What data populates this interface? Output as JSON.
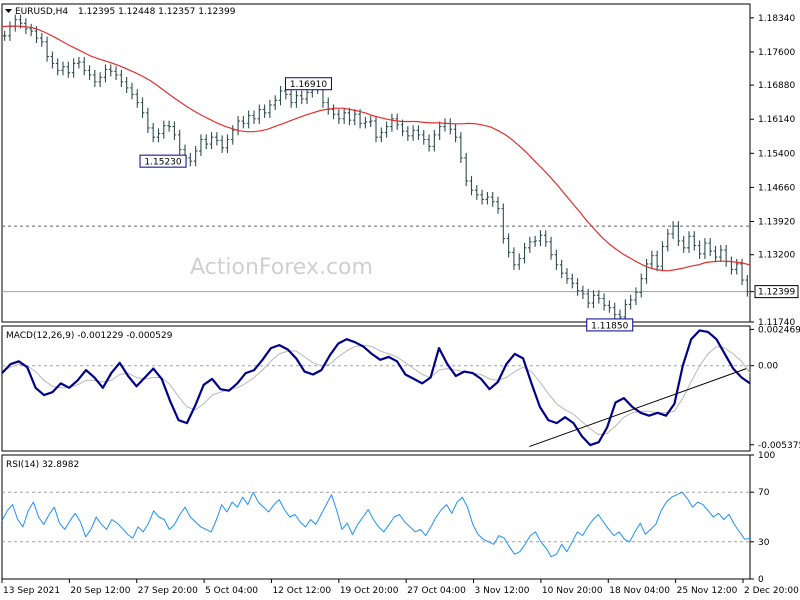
{
  "chart_data": {
    "type": "line",
    "price_panel": {
      "header_symbol": "EURUSD,H4",
      "header_ohlc": "1.12395 1.12448 1.12357 1.12399",
      "ylim": [
        1.1174,
        1.1864
      ],
      "y_ticks": [
        "1.18340",
        "1.17600",
        "1.16880",
        "1.16140",
        "1.15400",
        "1.14660",
        "1.13920",
        "1.13200",
        "1.12399",
        "1.11740"
      ],
      "annotations": [
        {
          "text": "1.16910",
          "x": 59,
          "y": 1.1691
        },
        {
          "text": "1.15230",
          "x": 31,
          "y": 1.1523
        },
        {
          "text": "1.11850",
          "x": 117,
          "y": 1.1185
        }
      ],
      "level_lines": [
        {
          "value": 1.1382,
          "label": "1.13820",
          "style": "dashed"
        },
        {
          "value": 1.12399,
          "label": "1.12399",
          "style": "solid"
        }
      ],
      "watermark": "ActionForex.com",
      "price_series": [
        1.1795,
        1.1815,
        1.183,
        1.1822,
        1.181,
        1.1805,
        1.179,
        1.1782,
        1.175,
        1.1735,
        1.172,
        1.1728,
        1.1715,
        1.1735,
        1.1738,
        1.172,
        1.171,
        1.1695,
        1.1705,
        1.1722,
        1.1718,
        1.171,
        1.1695,
        1.1682,
        1.1668,
        1.165,
        1.1628,
        1.1595,
        1.1575,
        1.1583,
        1.16,
        1.1598,
        1.158,
        1.1548,
        1.153,
        1.1523,
        1.1545,
        1.157,
        1.156,
        1.1575,
        1.1568,
        1.1552,
        1.157,
        1.159,
        1.161,
        1.1605,
        1.1622,
        1.1615,
        1.1635,
        1.1628,
        1.1645,
        1.1655,
        1.1675,
        1.1668,
        1.165,
        1.1665,
        1.1658,
        1.1672,
        1.168,
        1.1691,
        1.165,
        1.1635,
        1.1625,
        1.1615,
        1.1628,
        1.1612,
        1.1625,
        1.1605,
        1.1608,
        1.161,
        1.1575,
        1.1585,
        1.1598,
        1.1615,
        1.1602,
        1.1588,
        1.1578,
        1.159,
        1.158,
        1.157,
        1.1555,
        1.158,
        1.1598,
        1.1605,
        1.1592,
        1.1575,
        1.153,
        1.148,
        1.146,
        1.145,
        1.144,
        1.1445,
        1.1435,
        1.142,
        1.1355,
        1.1325,
        1.1298,
        1.1312,
        1.1335,
        1.1348,
        1.135,
        1.1362,
        1.1348,
        1.132,
        1.1298,
        1.128,
        1.1268,
        1.1258,
        1.1242,
        1.1235,
        1.1215,
        1.1232,
        1.1225,
        1.121,
        1.1205,
        1.119,
        1.1185,
        1.1212,
        1.1222,
        1.1238,
        1.1268,
        1.13,
        1.1318,
        1.1295,
        1.1338,
        1.1365,
        1.1382,
        1.135,
        1.1335,
        1.136,
        1.134,
        1.1322,
        1.1345,
        1.1328,
        1.1315,
        1.133,
        1.1305,
        1.1288,
        1.13,
        1.1265,
        1.124
      ],
      "ma_series": [
        1.1815,
        1.1816,
        1.1816,
        1.1815,
        1.1813,
        1.1808,
        1.1801,
        1.1793,
        1.1784,
        1.1775,
        1.1767,
        1.1759,
        1.1751,
        1.1745,
        1.174,
        1.1735,
        1.1729,
        1.1722,
        1.1715,
        1.1707,
        1.1698,
        1.1687,
        1.1675,
        1.1663,
        1.1652,
        1.1641,
        1.1631,
        1.1622,
        1.1614,
        1.1606,
        1.1599,
        1.1594,
        1.1589,
        1.1587,
        1.1587,
        1.1589,
        1.1593,
        1.1599,
        1.1605,
        1.1611,
        1.1617,
        1.1623,
        1.1628,
        1.1633,
        1.1636,
        1.1638,
        1.1638,
        1.1635,
        1.1632,
        1.1628,
        1.1622,
        1.1618,
        1.1614,
        1.1611,
        1.1609,
        1.1609,
        1.1609,
        1.1607,
        1.1606,
        1.1606,
        1.1605,
        1.1604,
        1.1604,
        1.1605,
        1.1604,
        1.1601,
        1.1597,
        1.1589,
        1.158,
        1.1568,
        1.1554,
        1.1539,
        1.1522,
        1.1506,
        1.1489,
        1.1471,
        1.1451,
        1.1432,
        1.1413,
        1.1393,
        1.1375,
        1.1358,
        1.1343,
        1.1331,
        1.132,
        1.1311,
        1.1302,
        1.1294,
        1.1289,
        1.1286,
        1.1285,
        1.1288,
        1.1291,
        1.1295,
        1.1298,
        1.1303,
        1.1305,
        1.1306,
        1.1306,
        1.1304,
        1.1302,
        1.1298
      ]
    },
    "macd_panel": {
      "header": "MACD(12,26,9) -0.001229 -0.000529",
      "ylim": [
        -0.0058,
        0.0027
      ],
      "y_ticks": [
        "0.002469",
        "0.00",
        "-0.005375"
      ],
      "macd_series": [
        -0.0005,
        0.0001,
        0.0003,
        -0.0001,
        -0.0015,
        -0.002,
        -0.0018,
        -0.0012,
        -0.0015,
        -0.001,
        -0.0003,
        -0.0008,
        -0.0015,
        -0.0005,
        0.0002,
        -0.0007,
        -0.0014,
        -0.0008,
        -0.0002,
        -0.0009,
        -0.0024,
        -0.0037,
        -0.0039,
        -0.0027,
        -0.0013,
        -0.0009,
        -0.0016,
        -0.0017,
        -0.0012,
        -0.0005,
        -0.0003,
        0.0004,
        0.0012,
        0.0014,
        0.0011,
        0.0005,
        -0.0004,
        -0.0006,
        -0.0003,
        0.0007,
        0.0015,
        0.0018,
        0.0016,
        0.0013,
        0.0008,
        0.0004,
        0.0006,
        0.0003,
        -0.0006,
        -0.0009,
        -0.0012,
        -0.0008,
        0.0012,
        0.0001,
        -0.0007,
        -0.0004,
        -0.0005,
        -0.0009,
        -0.0016,
        -0.0011,
        0.0001,
        0.0008,
        0.0005,
        -0.0012,
        -0.0028,
        -0.0037,
        -0.0039,
        -0.0035,
        -0.0039,
        -0.0048,
        -0.0054,
        -0.0052,
        -0.0042,
        -0.0025,
        -0.0022,
        -0.0028,
        -0.0032,
        -0.0034,
        -0.0032,
        -0.0034,
        -0.0026,
        0.0,
        0.0018,
        0.0024,
        0.0023,
        0.0018,
        0.0008,
        -0.0002,
        -0.0008,
        -0.0012
      ],
      "signal_series": [
        -0.0004,
        -0.0001,
        0.0001,
        0.0,
        -0.0004,
        -0.001,
        -0.0014,
        -0.0015,
        -0.0015,
        -0.0013,
        -0.001,
        -0.001,
        -0.0011,
        -0.001,
        -0.0006,
        -0.0005,
        -0.0008,
        -0.0009,
        -0.0008,
        -0.0008,
        -0.0013,
        -0.0021,
        -0.0028,
        -0.003,
        -0.0026,
        -0.002,
        -0.0018,
        -0.0016,
        -0.0015,
        -0.0012,
        -0.0008,
        -0.0003,
        0.0003,
        0.0008,
        0.001,
        0.001,
        0.0006,
        0.0002,
        0.0,
        0.0001,
        0.0006,
        0.001,
        0.0013,
        0.0014,
        0.0013,
        0.001,
        0.0008,
        0.0006,
        0.0002,
        -0.0002,
        -0.0006,
        -0.0008,
        -0.0003,
        -0.0002,
        -0.0003,
        -0.0004,
        -0.0005,
        -0.0006,
        -0.0009,
        -0.001,
        -0.0008,
        -0.0004,
        -0.0001,
        -0.0004,
        -0.0011,
        -0.0019,
        -0.0026,
        -0.003,
        -0.0033,
        -0.0038,
        -0.0043,
        -0.0047,
        -0.0046,
        -0.0041,
        -0.0035,
        -0.0032,
        -0.0031,
        -0.0031,
        -0.0032,
        -0.0032,
        -0.0031,
        -0.0022,
        -0.0011,
        0.0,
        0.0008,
        0.0013,
        0.0012,
        0.0008,
        0.0003,
        -0.0005
      ],
      "trendline": {
        "from": [
          0.705,
          -0.0055
        ],
        "to": [
          0.995,
          -0.0002
        ]
      }
    },
    "rsi_panel": {
      "header": "RSI(14) 32.8982",
      "ylim": [
        0,
        100
      ],
      "y_ticks": [
        "100",
        "70",
        "30",
        "0"
      ],
      "levels": [
        70,
        30
      ],
      "rsi_series": [
        47,
        55,
        60,
        48,
        42,
        55,
        62,
        50,
        44,
        52,
        58,
        45,
        40,
        47,
        53,
        46,
        34,
        40,
        50,
        44,
        40,
        48,
        45,
        41,
        36,
        33,
        42,
        38,
        45,
        55,
        50,
        48,
        40,
        44,
        52,
        58,
        50,
        46,
        42,
        40,
        38,
        48,
        60,
        54,
        62,
        58,
        66,
        60,
        70,
        62,
        58,
        54,
        60,
        64,
        56,
        50,
        52,
        46,
        42,
        48,
        44,
        52,
        60,
        68,
        55,
        40,
        45,
        36,
        44,
        50,
        56,
        48,
        42,
        38,
        44,
        50,
        52,
        46,
        42,
        38,
        40,
        35,
        42,
        50,
        56,
        60,
        53,
        62,
        66,
        58,
        44,
        36,
        32,
        30,
        28,
        35,
        33,
        26,
        20,
        22,
        28,
        35,
        38,
        30,
        25,
        18,
        20,
        28,
        22,
        30,
        38,
        35,
        42,
        48,
        52,
        46,
        40,
        35,
        38,
        32,
        30,
        38,
        45,
        36,
        40,
        44,
        55,
        62,
        66,
        68,
        70,
        65,
        58,
        62,
        60,
        55,
        50,
        53,
        48,
        52,
        44,
        38,
        32,
        33
      ]
    },
    "x_axis": {
      "labels": [
        "13 Sep 2021",
        "20 Sep 12:00",
        "27 Sep 20:00",
        "5 Oct 04:00",
        "12 Oct 12:00",
        "19 Oct 20:00",
        "27 Oct 04:00",
        "3 Nov 12:00",
        "10 Nov 20:00",
        "18 Nov 04:00",
        "25 Nov 12:00",
        "2 Dec 20:00"
      ]
    }
  },
  "colors": {
    "candle": "#2f4f4f",
    "ma": "#e03030",
    "macd": "#00008b",
    "signal": "#b8b8b8",
    "rsi": "#1e90ff",
    "grid_dash": "#a0a0a0",
    "frame": "#000000",
    "label_bg": "#ffffff"
  }
}
